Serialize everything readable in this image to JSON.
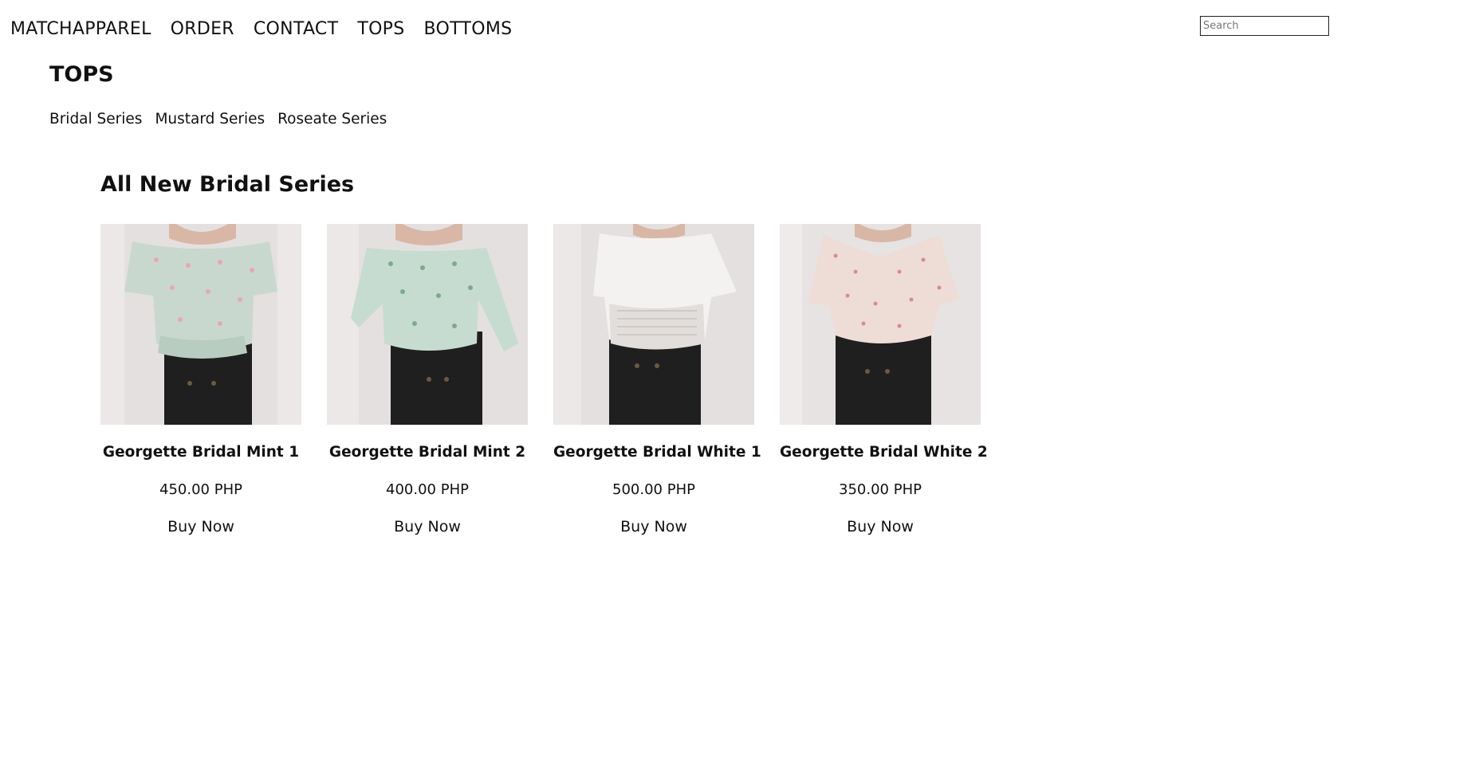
{
  "nav": {
    "links": [
      {
        "label": "MATCHAPPAREL"
      },
      {
        "label": "ORDER"
      },
      {
        "label": "CONTACT"
      },
      {
        "label": "TOPS"
      },
      {
        "label": "BOTTOMS"
      }
    ],
    "search_placeholder": "Search"
  },
  "page": {
    "title": "TOPS",
    "series_links": [
      {
        "label": "Bridal Series"
      },
      {
        "label": "Mustard Series"
      },
      {
        "label": "Roseate Series"
      }
    ],
    "collection_heading": "All New Bridal Series"
  },
  "products": [
    {
      "name": "Georgette Bridal Mint 1",
      "price": "450.00 PHP",
      "cta": "Buy Now",
      "top_color": "#c9d8cf",
      "print_color": "#e8a7b3"
    },
    {
      "name": "Georgette Bridal Mint 2",
      "price": "400.00 PHP",
      "cta": "Buy Now",
      "top_color": "#c6dcd0",
      "print_color": "#7fa88f"
    },
    {
      "name": "Georgette Bridal White 1",
      "price": "500.00 PHP",
      "cta": "Buy Now",
      "top_color": "#f4f2f0",
      "print_color": "#e2dedb"
    },
    {
      "name": "Georgette Bridal White 2",
      "price": "350.00 PHP",
      "cta": "Buy Now",
      "top_color": "#eeddd6",
      "print_color": "#d98a95"
    }
  ]
}
